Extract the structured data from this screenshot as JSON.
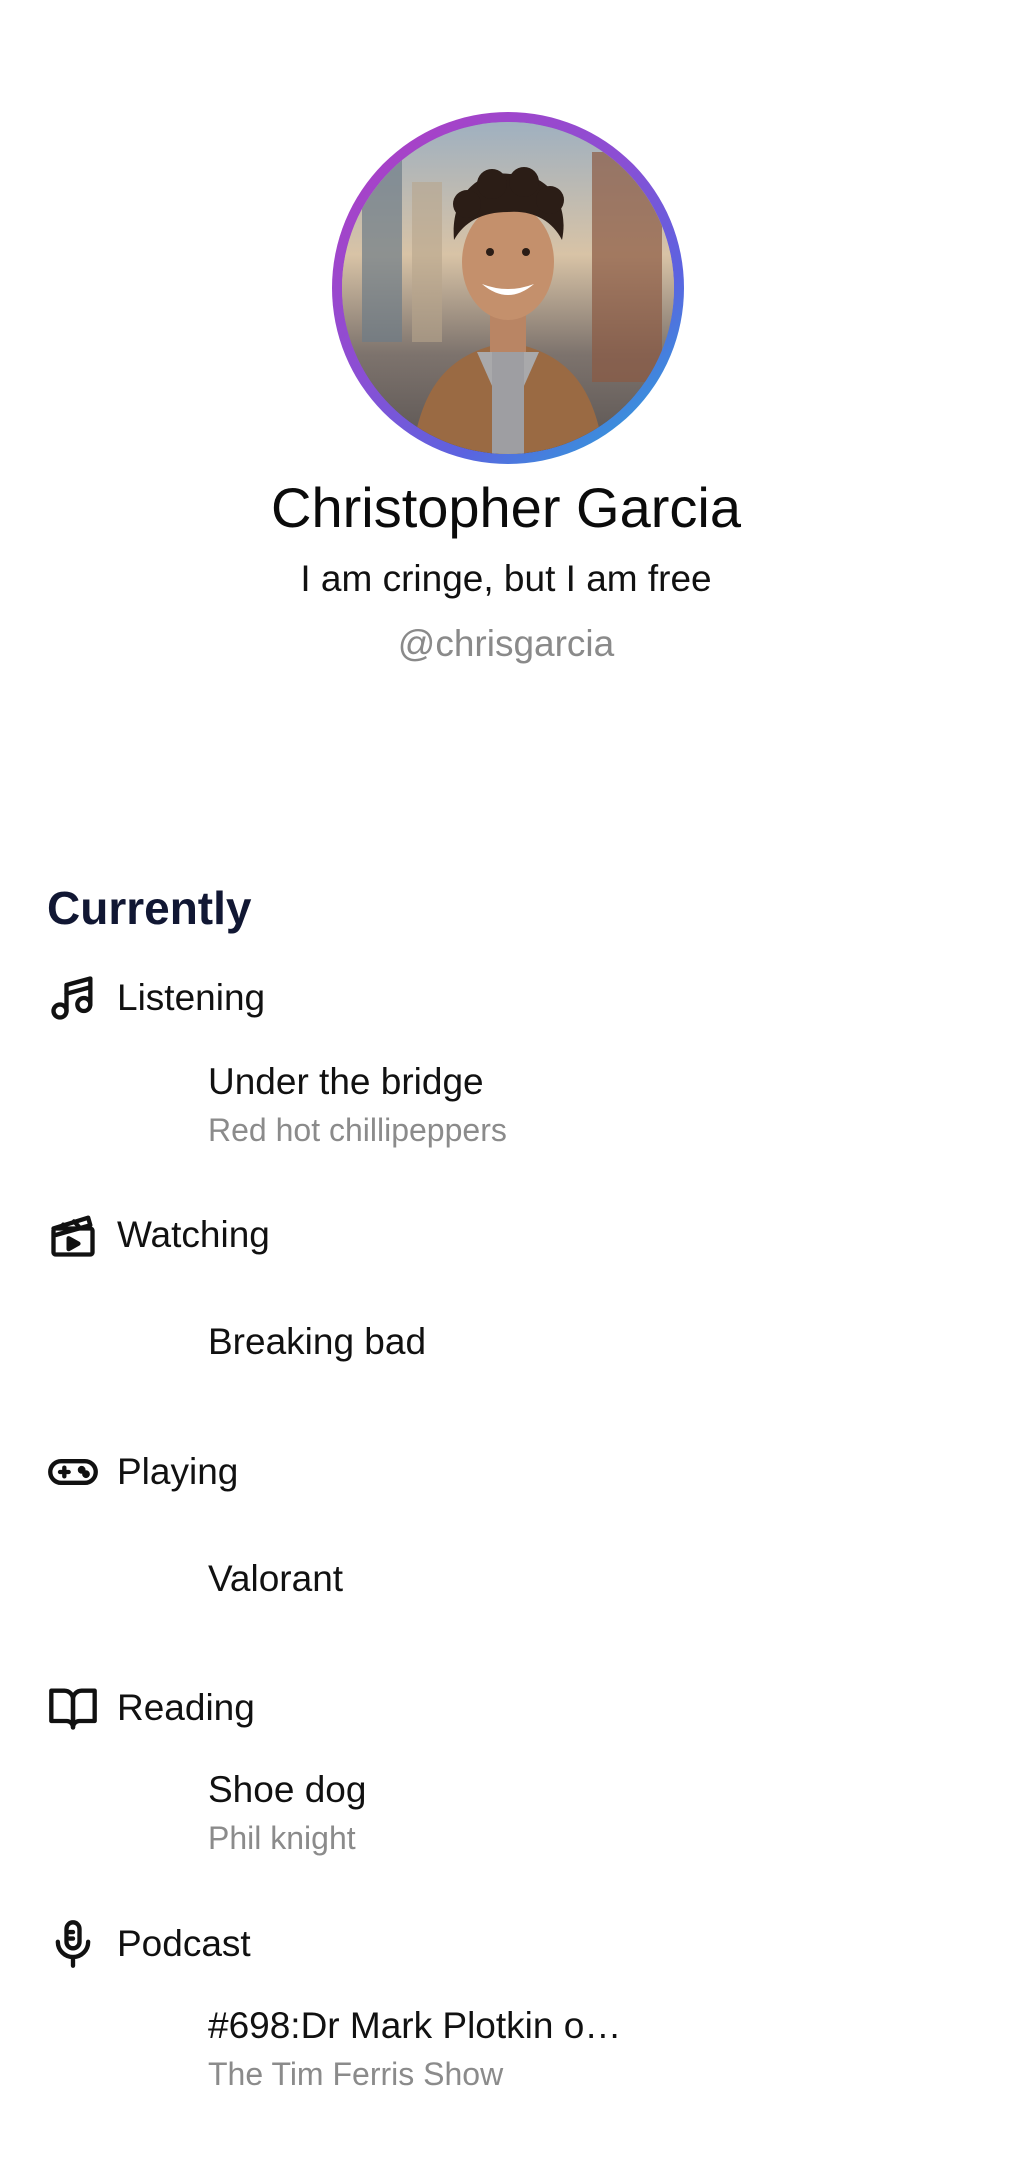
{
  "profile": {
    "name": "Christopher Garcia",
    "bio": "I am cringe, but I am free",
    "handle": "@chrisgarcia",
    "ring_gradient": [
      "#b43cc2",
      "#5b63e0",
      "#1fb4d9"
    ]
  },
  "currently": {
    "title": "Currently",
    "title_color": "#111733",
    "categories": [
      {
        "label": "Listening",
        "icon": "music-note-icon",
        "title": "Under the bridge",
        "subtitle": "Red hot chillipeppers"
      },
      {
        "label": "Watching",
        "icon": "clapperboard-icon",
        "title": "Breaking bad",
        "subtitle": ""
      },
      {
        "label": "Playing",
        "icon": "gamepad-icon",
        "title": "Valorant",
        "subtitle": ""
      },
      {
        "label": "Reading",
        "icon": "book-icon",
        "title": "Shoe dog",
        "subtitle": "Phil knight"
      },
      {
        "label": "Podcast",
        "icon": "microphone-icon",
        "title": "#698:Dr Mark Plotkin o…",
        "subtitle": "The Tim Ferris Show"
      }
    ]
  }
}
